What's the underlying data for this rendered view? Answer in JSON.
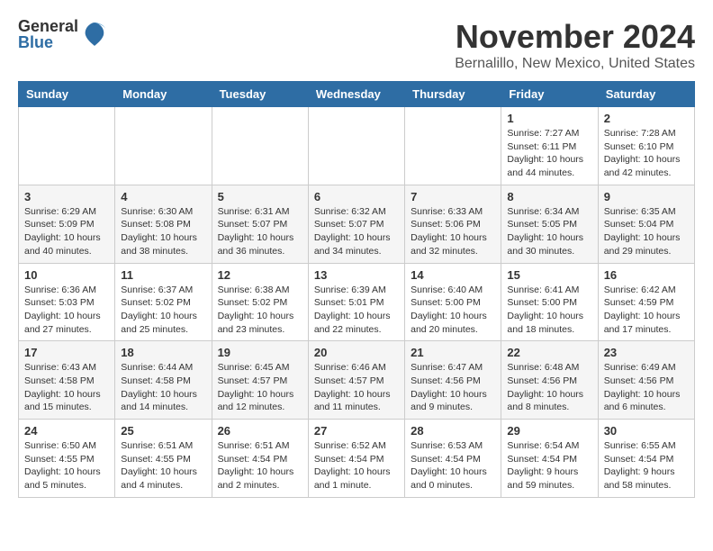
{
  "header": {
    "logo_general": "General",
    "logo_blue": "Blue",
    "title": "November 2024",
    "subtitle": "Bernalillo, New Mexico, United States"
  },
  "days_of_week": [
    "Sunday",
    "Monday",
    "Tuesday",
    "Wednesday",
    "Thursday",
    "Friday",
    "Saturday"
  ],
  "weeks": [
    [
      {
        "day": "",
        "info": ""
      },
      {
        "day": "",
        "info": ""
      },
      {
        "day": "",
        "info": ""
      },
      {
        "day": "",
        "info": ""
      },
      {
        "day": "",
        "info": ""
      },
      {
        "day": "1",
        "info": "Sunrise: 7:27 AM\nSunset: 6:11 PM\nDaylight: 10 hours and 44 minutes."
      },
      {
        "day": "2",
        "info": "Sunrise: 7:28 AM\nSunset: 6:10 PM\nDaylight: 10 hours and 42 minutes."
      }
    ],
    [
      {
        "day": "3",
        "info": "Sunrise: 6:29 AM\nSunset: 5:09 PM\nDaylight: 10 hours and 40 minutes."
      },
      {
        "day": "4",
        "info": "Sunrise: 6:30 AM\nSunset: 5:08 PM\nDaylight: 10 hours and 38 minutes."
      },
      {
        "day": "5",
        "info": "Sunrise: 6:31 AM\nSunset: 5:07 PM\nDaylight: 10 hours and 36 minutes."
      },
      {
        "day": "6",
        "info": "Sunrise: 6:32 AM\nSunset: 5:07 PM\nDaylight: 10 hours and 34 minutes."
      },
      {
        "day": "7",
        "info": "Sunrise: 6:33 AM\nSunset: 5:06 PM\nDaylight: 10 hours and 32 minutes."
      },
      {
        "day": "8",
        "info": "Sunrise: 6:34 AM\nSunset: 5:05 PM\nDaylight: 10 hours and 30 minutes."
      },
      {
        "day": "9",
        "info": "Sunrise: 6:35 AM\nSunset: 5:04 PM\nDaylight: 10 hours and 29 minutes."
      }
    ],
    [
      {
        "day": "10",
        "info": "Sunrise: 6:36 AM\nSunset: 5:03 PM\nDaylight: 10 hours and 27 minutes."
      },
      {
        "day": "11",
        "info": "Sunrise: 6:37 AM\nSunset: 5:02 PM\nDaylight: 10 hours and 25 minutes."
      },
      {
        "day": "12",
        "info": "Sunrise: 6:38 AM\nSunset: 5:02 PM\nDaylight: 10 hours and 23 minutes."
      },
      {
        "day": "13",
        "info": "Sunrise: 6:39 AM\nSunset: 5:01 PM\nDaylight: 10 hours and 22 minutes."
      },
      {
        "day": "14",
        "info": "Sunrise: 6:40 AM\nSunset: 5:00 PM\nDaylight: 10 hours and 20 minutes."
      },
      {
        "day": "15",
        "info": "Sunrise: 6:41 AM\nSunset: 5:00 PM\nDaylight: 10 hours and 18 minutes."
      },
      {
        "day": "16",
        "info": "Sunrise: 6:42 AM\nSunset: 4:59 PM\nDaylight: 10 hours and 17 minutes."
      }
    ],
    [
      {
        "day": "17",
        "info": "Sunrise: 6:43 AM\nSunset: 4:58 PM\nDaylight: 10 hours and 15 minutes."
      },
      {
        "day": "18",
        "info": "Sunrise: 6:44 AM\nSunset: 4:58 PM\nDaylight: 10 hours and 14 minutes."
      },
      {
        "day": "19",
        "info": "Sunrise: 6:45 AM\nSunset: 4:57 PM\nDaylight: 10 hours and 12 minutes."
      },
      {
        "day": "20",
        "info": "Sunrise: 6:46 AM\nSunset: 4:57 PM\nDaylight: 10 hours and 11 minutes."
      },
      {
        "day": "21",
        "info": "Sunrise: 6:47 AM\nSunset: 4:56 PM\nDaylight: 10 hours and 9 minutes."
      },
      {
        "day": "22",
        "info": "Sunrise: 6:48 AM\nSunset: 4:56 PM\nDaylight: 10 hours and 8 minutes."
      },
      {
        "day": "23",
        "info": "Sunrise: 6:49 AM\nSunset: 4:56 PM\nDaylight: 10 hours and 6 minutes."
      }
    ],
    [
      {
        "day": "24",
        "info": "Sunrise: 6:50 AM\nSunset: 4:55 PM\nDaylight: 10 hours and 5 minutes."
      },
      {
        "day": "25",
        "info": "Sunrise: 6:51 AM\nSunset: 4:55 PM\nDaylight: 10 hours and 4 minutes."
      },
      {
        "day": "26",
        "info": "Sunrise: 6:51 AM\nSunset: 4:54 PM\nDaylight: 10 hours and 2 minutes."
      },
      {
        "day": "27",
        "info": "Sunrise: 6:52 AM\nSunset: 4:54 PM\nDaylight: 10 hours and 1 minute."
      },
      {
        "day": "28",
        "info": "Sunrise: 6:53 AM\nSunset: 4:54 PM\nDaylight: 10 hours and 0 minutes."
      },
      {
        "day": "29",
        "info": "Sunrise: 6:54 AM\nSunset: 4:54 PM\nDaylight: 9 hours and 59 minutes."
      },
      {
        "day": "30",
        "info": "Sunrise: 6:55 AM\nSunset: 4:54 PM\nDaylight: 9 hours and 58 minutes."
      }
    ]
  ]
}
